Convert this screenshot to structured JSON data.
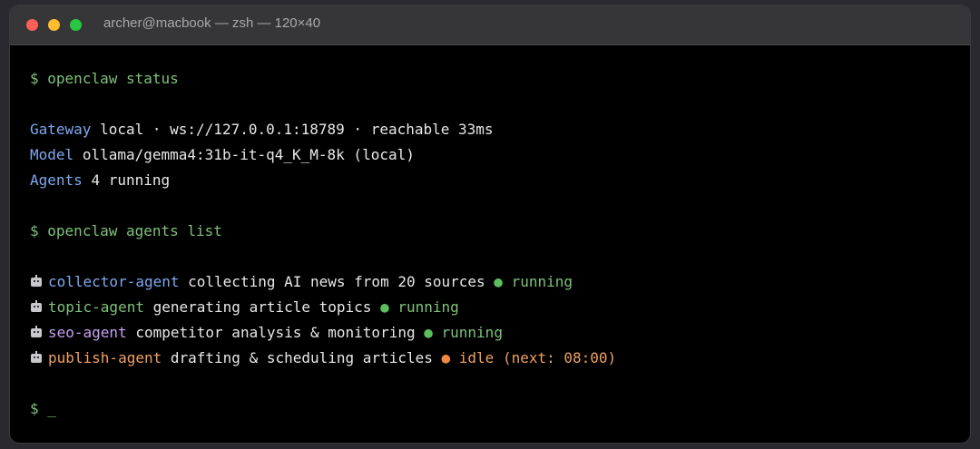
{
  "window": {
    "title": "archer@macbook — zsh — 120×40"
  },
  "terminal": {
    "prompt": "$",
    "cmd_status": "openclaw status",
    "gateway_label": "Gateway",
    "gateway_value": "local · ws://127.0.0.1:18789 · reachable 33ms",
    "model_label": "Model",
    "model_value": "ollama/gemma4:31b-it-q4_K_M-8k (local)",
    "agents_label": "Agents",
    "agents_value": "4 running",
    "cmd_list": "openclaw agents list",
    "agents": [
      {
        "name": "collector-agent",
        "desc": "collecting AI news from 20 sources",
        "dot": "●",
        "status": "running"
      },
      {
        "name": "topic-agent",
        "desc": "generating article topics",
        "dot": "●",
        "status": "running"
      },
      {
        "name": "seo-agent",
        "desc": "competitor analysis & monitoring",
        "dot": "●",
        "status": "running"
      },
      {
        "name": "publish-agent",
        "desc": "drafting & scheduling articles",
        "dot": "●",
        "status": "idle (next: 08:00)"
      }
    ],
    "cursor": "_"
  },
  "colors": {
    "red": "#ff5f57",
    "yellow": "#febc2e",
    "green": "#28c840",
    "prompt_green": "#7ec27a",
    "key_blue": "#7ea8f0",
    "purple": "#c8a0f0",
    "orange": "#f0a060"
  },
  "icons": {
    "agent_icon": "robot-icon"
  }
}
